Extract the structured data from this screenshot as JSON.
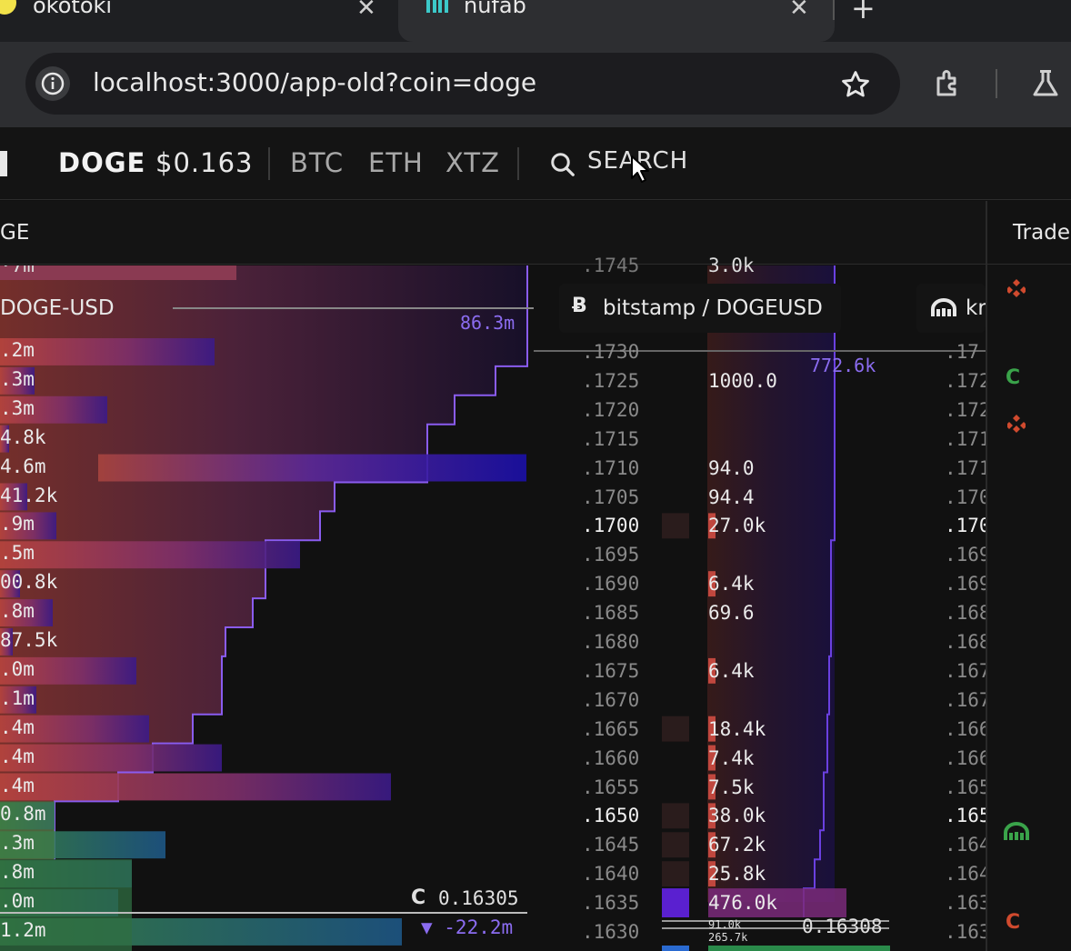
{
  "browser": {
    "tabs": [
      {
        "title": "okotoki",
        "close": "✕"
      },
      {
        "title": "nufab",
        "close": "✕"
      }
    ],
    "new_tab": "+",
    "url": "localhost:3000/app-old?coin=doge"
  },
  "nav": {
    "coin": "DOGE",
    "price": "$0.163",
    "coins": [
      "BTC",
      "ETH",
      "XTZ"
    ],
    "search_label": "SEARCH"
  },
  "panel": {
    "left_title": "GE",
    "right_title": "Trade"
  },
  "left_book": {
    "market_label": "DOGE-USD",
    "top_total": "86.3m",
    "top_partial": "·7m",
    "rows": [
      ".2m",
      ".3m",
      ".3m",
      "4.8k",
      "4.6m",
      "41.2k",
      ".9m",
      ".5m",
      "00.8k",
      ".8m",
      "87.5k",
      ".0m",
      ".1m",
      ".4m",
      ".4m",
      ".4m",
      "0.8m",
      ".3m",
      ".8m",
      ".0m",
      "1.2m"
    ],
    "last_price": "0.16305",
    "change": "▼ -22.2m"
  },
  "mid_book": {
    "exchange_label": "bitstamp / DOGEUSD",
    "next_exchange_label": "kr",
    "ask_total": "772.6k",
    "top_price": ".1745",
    "top_size": "3.0k",
    "prices": [
      ".1730",
      ".1725",
      ".1720",
      ".1715",
      ".1710",
      ".1705",
      ".1700",
      ".1695",
      ".1690",
      ".1685",
      ".1680",
      ".1675",
      ".1670",
      ".1665",
      ".1660",
      ".1655",
      ".1650",
      ".1645",
      ".1640",
      ".1635",
      ".1630"
    ],
    "sizes": [
      "",
      "1000.0",
      "",
      "",
      "94.0",
      "94.4",
      "27.0k",
      "",
      "6.4k",
      "69.6",
      "",
      "6.4k",
      "",
      "18.4k",
      "7.4k",
      "7.5k",
      "38.0k",
      "67.2k",
      "25.8k",
      "476.0k",
      ""
    ],
    "mid_price": "0.16308",
    "small_a": "91.0k",
    "small_b": "265.7k",
    "right_prices": [
      ".17",
      ".172",
      ".172",
      ".171",
      ".171",
      ".170",
      ".170",
      ".169",
      ".169",
      ".168",
      ".168",
      ".167",
      ".167",
      ".166",
      ".166",
      ".165",
      ".165",
      ".164",
      ".164",
      ".163",
      ".163"
    ]
  },
  "colors": {
    "bid": "#3f8f4a",
    "ask": "#c0473e",
    "depth": "#5a22c8",
    "accent": "#8b6cf0"
  },
  "icons": [
    "info-icon",
    "star-icon",
    "extension-icon",
    "labs-icon",
    "search-icon",
    "bitstamp-icon",
    "kraken-icon",
    "binance-icon",
    "coinbase-icon"
  ]
}
